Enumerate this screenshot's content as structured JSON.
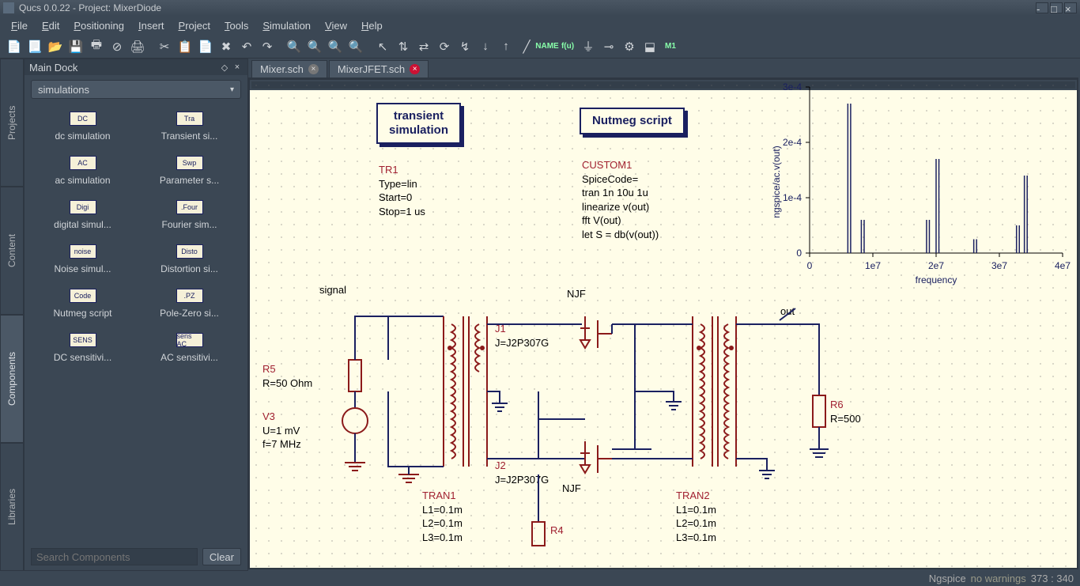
{
  "title": "Qucs 0.0.22 - Project: MixerDiode",
  "menu": [
    "File",
    "Edit",
    "Positioning",
    "Insert",
    "Project",
    "Tools",
    "Simulation",
    "View",
    "Help"
  ],
  "dock": {
    "title": "Main Dock",
    "sidetabs": [
      "Projects",
      "Content",
      "Components",
      "Libraries"
    ],
    "active_sidetab": 2,
    "combo": "simulations",
    "items": [
      {
        "ic": "DC",
        "label": "dc simulation"
      },
      {
        "ic": "Tra",
        "label": "Transient si..."
      },
      {
        "ic": "AC",
        "label": "ac simulation"
      },
      {
        "ic": "Swp",
        "label": "Parameter s..."
      },
      {
        "ic": "Digi",
        "label": "digital simul..."
      },
      {
        "ic": ".Four",
        "label": "Fourier sim..."
      },
      {
        "ic": "noise",
        "label": "Noise simul..."
      },
      {
        "ic": "Disto",
        "label": "Distortion si..."
      },
      {
        "ic": "Code",
        "label": "Nutmeg script"
      },
      {
        "ic": ".PZ",
        "label": "Pole-Zero si..."
      },
      {
        "ic": "SENS",
        "label": "DC sensitivi..."
      },
      {
        "ic": "sens AC",
        "label": "AC sensitivi..."
      }
    ],
    "search_placeholder": "Search Components",
    "clear": "Clear"
  },
  "tabs": [
    {
      "label": "Mixer.sch",
      "active": false
    },
    {
      "label": "MixerJFET.sch",
      "active": true
    }
  ],
  "sim1": {
    "title1": "transient",
    "title2": "simulation",
    "p": [
      "TR1",
      "Type=lin",
      "Start=0",
      "Stop=1 us"
    ]
  },
  "sim2": {
    "title": "Nutmeg script",
    "p": [
      "CUSTOM1",
      "SpiceCode=",
      "tran 1n 10u 1u",
      "linearize v(out)",
      "fft V(out)",
      "let S = db(v(out))"
    ]
  },
  "labels": {
    "signal": "signal",
    "out": "out",
    "njf1": "NJF",
    "njf2": "NJF"
  },
  "r5": [
    "R5",
    "R=50 Ohm"
  ],
  "v3": [
    "V3",
    "U=1 mV",
    "f=7 MHz"
  ],
  "j1": [
    "J1",
    "J=J2P307G"
  ],
  "j2": [
    "J2",
    "J=J2P307G"
  ],
  "r4": [
    "R4"
  ],
  "r6": [
    "R6",
    "R=500"
  ],
  "tran1": [
    "TRAN1",
    "L1=0.1m",
    "L2=0.1m",
    "L3=0.1m"
  ],
  "tran2": [
    "TRAN2",
    "L1=0.1m",
    "L2=0.1m",
    "L3=0.1m"
  ],
  "chart_data": {
    "type": "line",
    "xlabel": "frequency",
    "ylabel": "ngspice/ac.v(out)",
    "xlim": [
      0,
      45000000.0
    ],
    "ylim": [
      0,
      0.0003
    ],
    "xticks": [
      "0",
      "1e7",
      "2e7",
      "3e7",
      "4e7"
    ],
    "yticks": [
      "0",
      "1e-4",
      "2e-4",
      "3e-4"
    ],
    "peaks": [
      {
        "x": 6800000.0,
        "y": 0.00027
      },
      {
        "x": 7300000.0,
        "y": 0.00027
      },
      {
        "x": 9200000.0,
        "y": 6e-05
      },
      {
        "x": 9700000.0,
        "y": 6e-05
      },
      {
        "x": 20800000.0,
        "y": 6e-05
      },
      {
        "x": 21300000.0,
        "y": 6e-05
      },
      {
        "x": 22500000.0,
        "y": 0.00017
      },
      {
        "x": 23000000.0,
        "y": 0.00017
      },
      {
        "x": 29200000.0,
        "y": 2.5e-05
      },
      {
        "x": 29700000.0,
        "y": 2.5e-05
      },
      {
        "x": 36800000.0,
        "y": 5e-05
      },
      {
        "x": 37300000.0,
        "y": 5e-05
      },
      {
        "x": 38200000.0,
        "y": 0.00014
      },
      {
        "x": 38700000.0,
        "y": 0.00014
      }
    ]
  },
  "status": {
    "engine": "Ngspice",
    "warn": "no warnings",
    "coords": "373 : 340"
  }
}
